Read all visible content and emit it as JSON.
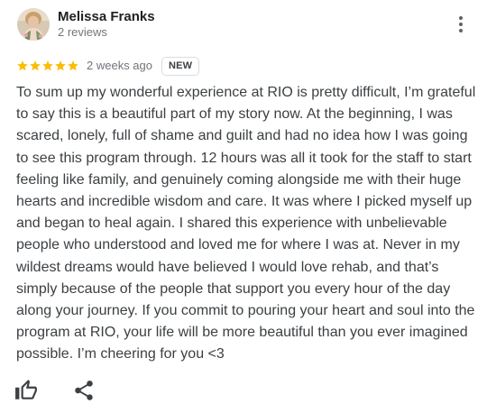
{
  "review": {
    "author": {
      "name": "Melissa Franks",
      "review_count": "2 reviews",
      "avatar_icon": "profile-photo"
    },
    "menu_icon": "more-vert-icon",
    "rating": {
      "stars": 5,
      "max_stars": 5,
      "star_color": "#fbbc04"
    },
    "date": "2 weeks ago",
    "badge": "NEW",
    "text": "To sum up my wonderful experience at RIO is pretty difficult, I’m grateful to say this is a beautiful part of my story now. At the beginning, I was scared, lonely, full of shame and guilt and had no idea how I was going to see this program through. 12 hours was all it took for the staff to start feeling like family, and genuinely coming alongside me with their huge hearts and incredible wisdom and care. It was where I picked myself up and began to heal again. I shared this experience with unbelievable people who understood and loved me for where I was at. Never in my wildest dreams would have believed I would love rehab, and that’s simply because of the people that support you every hour of the day along your journey. If you commit to pouring your heart and soul into the program at RIO, your life will be more beautiful than you ever imagined possible. I’m cheering for you <3",
    "actions": {
      "like_icon": "thumbs-up-icon",
      "share_icon": "share-icon"
    }
  }
}
